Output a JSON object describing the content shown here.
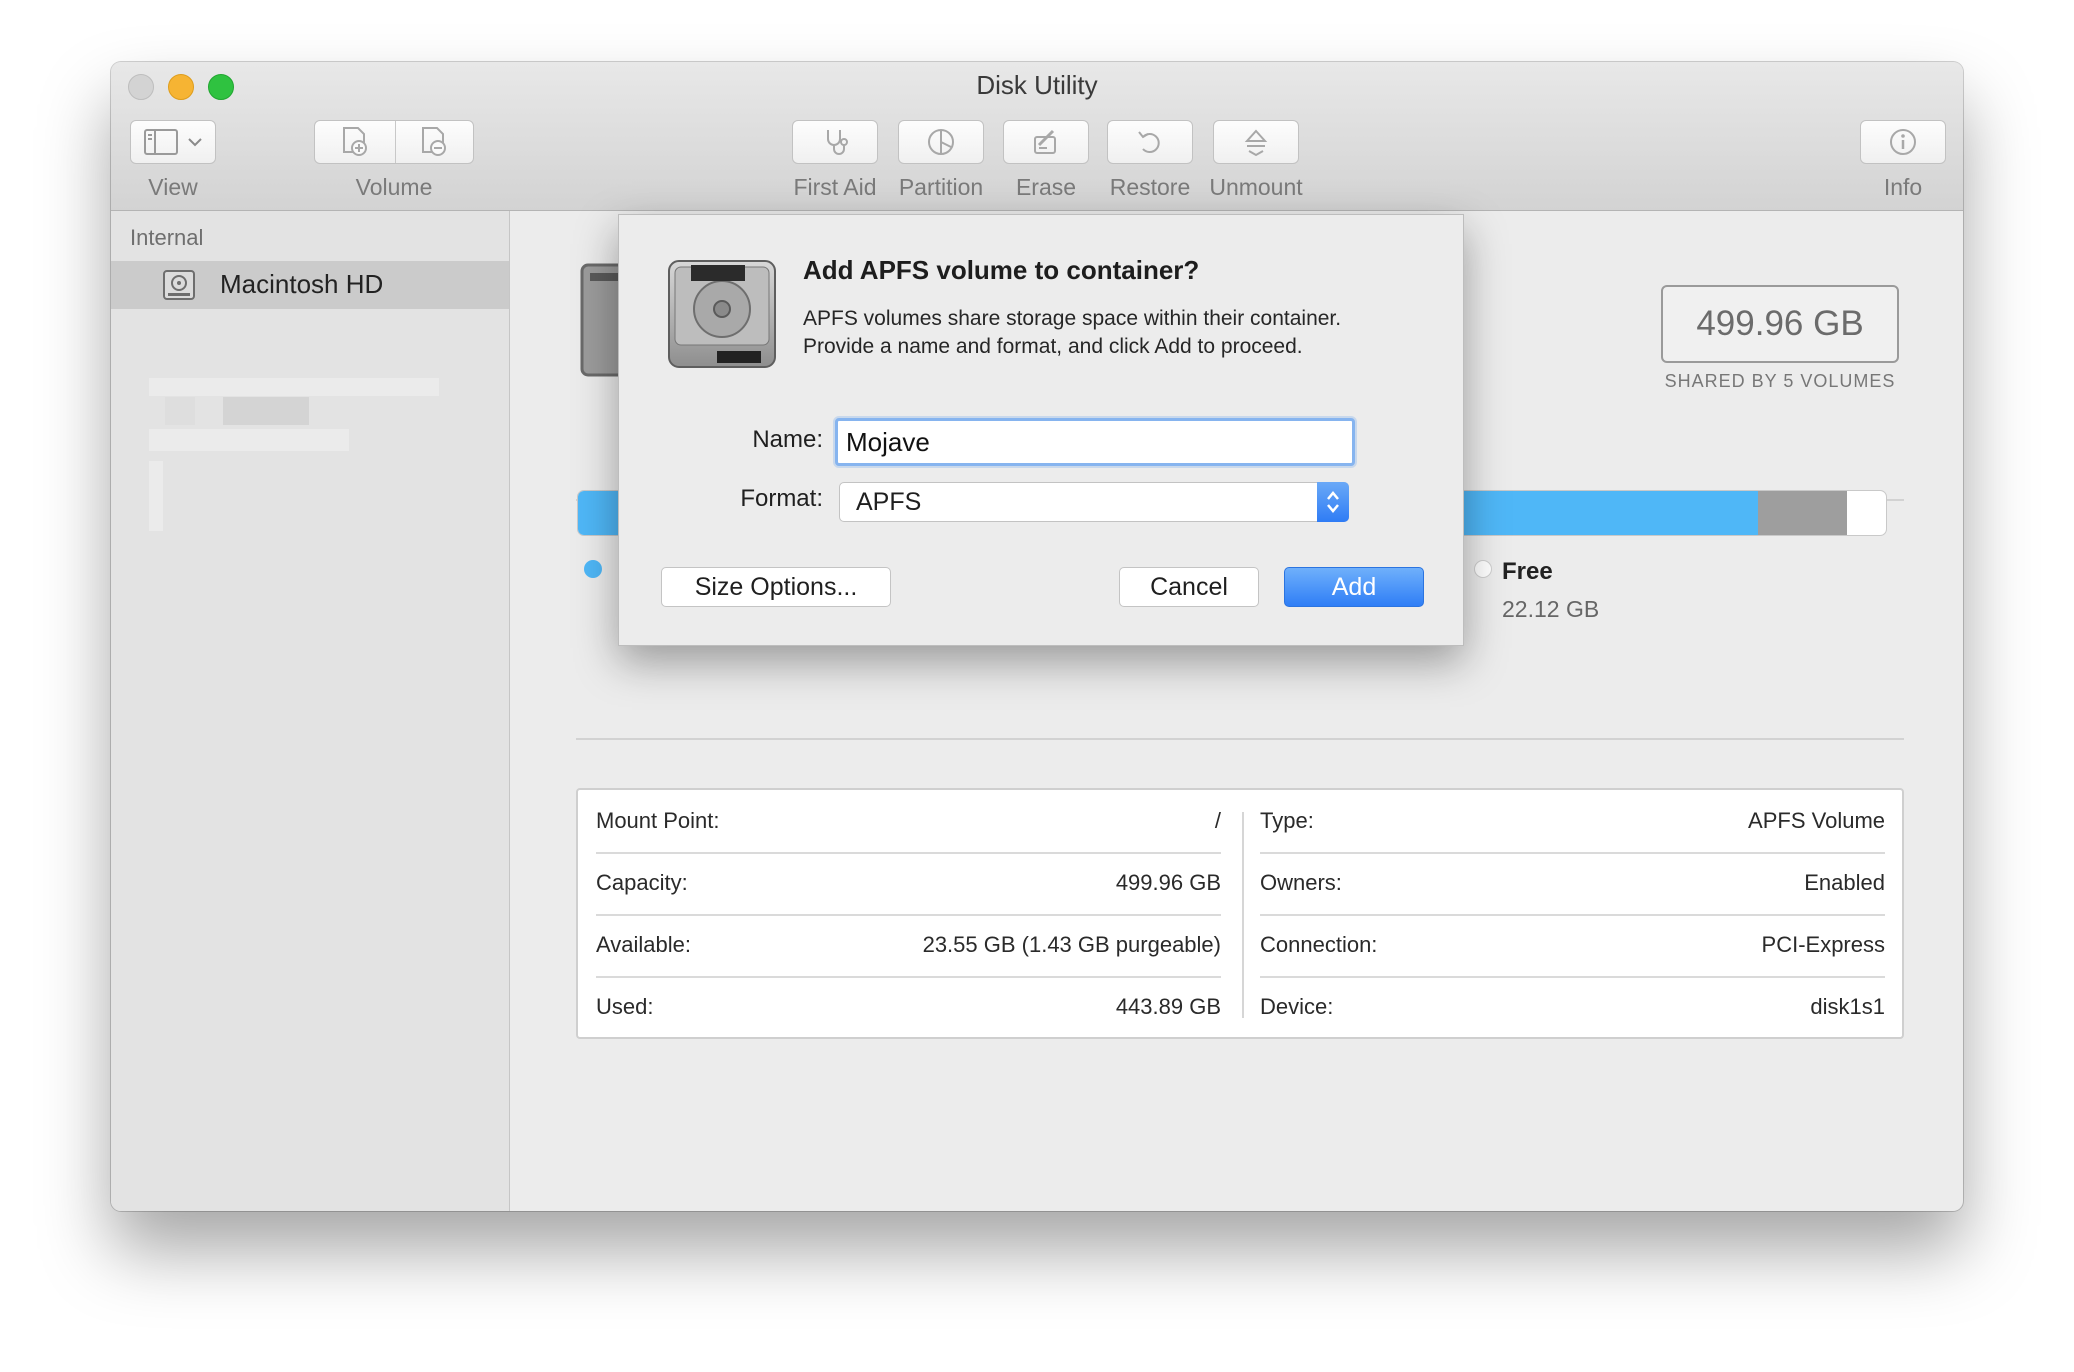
{
  "window": {
    "title": "Disk Utility"
  },
  "toolbar": {
    "view_label": "View",
    "volume_label": "Volume",
    "first_aid_label": "First Aid",
    "partition_label": "Partition",
    "erase_label": "Erase",
    "restore_label": "Restore",
    "unmount_label": "Unmount",
    "info_label": "Info"
  },
  "sidebar": {
    "section_header": "Internal",
    "items": [
      {
        "label": "Macintosh HD",
        "icon": "internal-disk-icon",
        "selected": true
      }
    ]
  },
  "volume": {
    "capacity": "499.96 GB",
    "shared_by": "SHARED BY 5 VOLUMES",
    "free_label": "Free",
    "free_value": "22.12 GB"
  },
  "colors": {
    "used": "#4fb7f7",
    "other": "#9e9e9e",
    "free": "#ffffff",
    "accent": "#2f7ef6"
  },
  "info_table": {
    "left": [
      {
        "key": "Mount Point:",
        "value": "/"
      },
      {
        "key": "Capacity:",
        "value": "499.96 GB"
      },
      {
        "key": "Available:",
        "value": "23.55 GB (1.43 GB purgeable)"
      },
      {
        "key": "Used:",
        "value": "443.89 GB"
      }
    ],
    "right": [
      {
        "key": "Type:",
        "value": "APFS Volume"
      },
      {
        "key": "Owners:",
        "value": "Enabled"
      },
      {
        "key": "Connection:",
        "value": "PCI-Express"
      },
      {
        "key": "Device:",
        "value": "disk1s1"
      }
    ]
  },
  "dialog": {
    "title": "Add APFS volume to container?",
    "message_line1": "APFS volumes share storage space within their container.",
    "message_line2": "Provide a name and format, and click Add to proceed.",
    "name_label": "Name:",
    "name_value": "Mojave",
    "format_label": "Format:",
    "format_value": "APFS",
    "size_options_label": "Size Options...",
    "cancel_label": "Cancel",
    "add_label": "Add"
  }
}
